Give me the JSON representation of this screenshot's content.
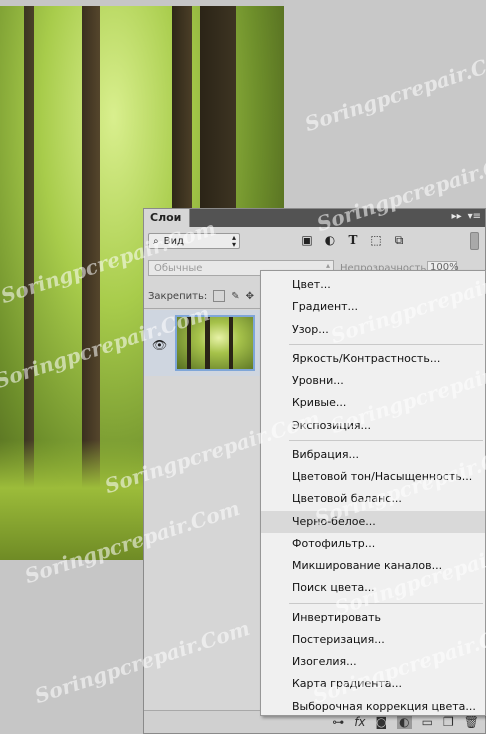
{
  "watermarks": [
    "Soringpcrepair.Com",
    "Soringpcrepair.Com",
    "Soringpcrepair.Com",
    "Soringpcrepair.Com",
    "Soringpcrepair.Com",
    "Soringpcrepair.Com",
    "Soringpcrepair.Com",
    "Soringpcrepair.Com",
    "Soringpcrepair.Com",
    "Soringpcrepair.Com",
    "Soringpcrepair.Com",
    "Soringpcrepair.Com"
  ],
  "panel": {
    "tab": "Слои",
    "kind_filter": "Вид",
    "blend_mode": "Обычные",
    "opacity_label": "Непрозрачность:",
    "opacity_value": "100%",
    "lock_label": "Закрепить:"
  },
  "menu": {
    "groups": [
      [
        "Цвет...",
        "Градиент...",
        "Узор..."
      ],
      [
        "Яркость/Контрастность...",
        "Уровни...",
        "Кривые...",
        "Экспозиция..."
      ],
      [
        "Вибрация...",
        "Цветовой тон/Насыщенность...",
        "Цветовой баланс...",
        "Черно-белое...",
        "Фотофильтр...",
        "Микширование каналов...",
        "Поиск цвета..."
      ],
      [
        "Инвертировать",
        "Постеризация...",
        "Изогелия...",
        "Карта градиента...",
        "Выборочная коррекция цвета..."
      ]
    ],
    "hovered": "Черно-белое..."
  }
}
